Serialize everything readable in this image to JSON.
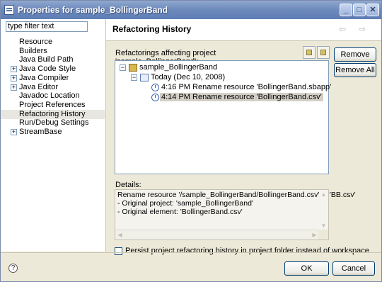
{
  "window": {
    "title": "Properties for sample_BollingerBand"
  },
  "title_buttons": {
    "minimize": "_",
    "maximize": "□",
    "close": "✕"
  },
  "filter": {
    "placeholder": "type filter text"
  },
  "nav": [
    {
      "label": "Resource",
      "expandable": false
    },
    {
      "label": "Builders",
      "expandable": false
    },
    {
      "label": "Java Build Path",
      "expandable": false
    },
    {
      "label": "Java Code Style",
      "expandable": true
    },
    {
      "label": "Java Compiler",
      "expandable": true
    },
    {
      "label": "Java Editor",
      "expandable": true
    },
    {
      "label": "Javadoc Location",
      "expandable": false
    },
    {
      "label": "Project References",
      "expandable": false
    },
    {
      "label": "Refactoring History",
      "expandable": false,
      "selected": true
    },
    {
      "label": "Run/Debug Settings",
      "expandable": false
    },
    {
      "label": "StreamBase",
      "expandable": true
    }
  ],
  "header": {
    "title": "Refactoring History",
    "back_icon": "⇦",
    "forward_icon": "⇨"
  },
  "panel": {
    "label": "Refactorings affecting project 'sample_BollingerBand':",
    "tree": {
      "project": "sample_BollingerBand",
      "date": "Today (Dec 10, 2008)",
      "entries": [
        "4:16 PM Rename resource 'BollingerBand.sbapp'",
        "4:14 PM Rename resource 'BollingerBand.csv'"
      ]
    }
  },
  "buttons": {
    "remove": "Remove",
    "remove_all": "Remove All",
    "ok": "OK",
    "cancel": "Cancel"
  },
  "details": {
    "label": "Details:",
    "lines": [
      "Rename resource '/sample_BollingerBand/BollingerBand.csv' to 'BB.csv'",
      "- Original project: 'sample_BollingerBand'",
      "- Original element: 'BollingerBand.csv'"
    ]
  },
  "persist_checkbox": {
    "label": "Persist project refactoring history in project folder instead of workspace",
    "checked": false
  },
  "help": {
    "icon": "?"
  }
}
